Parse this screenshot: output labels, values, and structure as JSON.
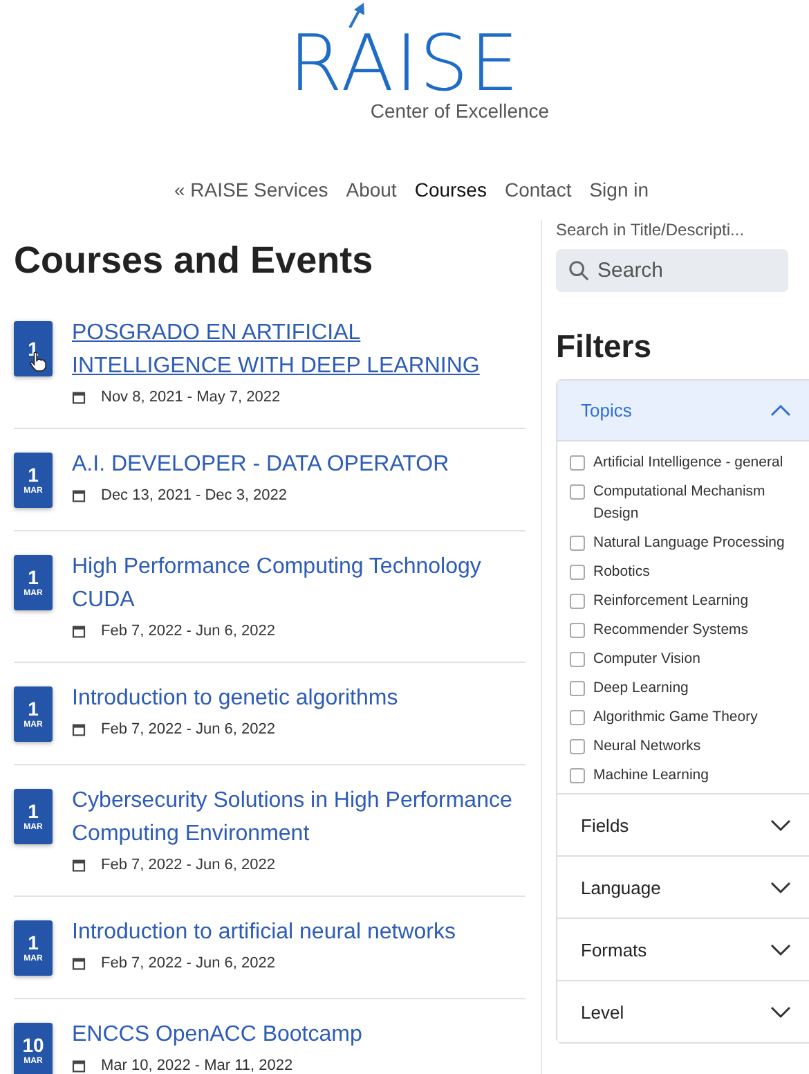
{
  "logo": {
    "name": "RAISE",
    "tagline": "Center of Excellence"
  },
  "nav": [
    {
      "label": "« RAISE Services",
      "selected": false
    },
    {
      "label": "About",
      "selected": false
    },
    {
      "label": "Courses",
      "selected": true
    },
    {
      "label": "Contact",
      "selected": false
    },
    {
      "label": "Sign in",
      "selected": false
    }
  ],
  "heading": "Courses and Events",
  "events": [
    {
      "day": "1",
      "title": "POSGRADO EN ARTIFICIAL INTELLIGENCE WITH DEEP LEARNING",
      "dates": "Nov 8, 2021 - May 7, 2022",
      "hovered": true
    },
    {
      "day": "1",
      "month": "MAR",
      "title": "A.I. DEVELOPER - DATA OPERATOR",
      "dates": "Dec 13, 2021 - Dec 3, 2022",
      "hovered": false
    },
    {
      "day": "1",
      "month": "MAR",
      "title": "High Performance Computing Technology CUDA",
      "dates": "Feb 7, 2022 - Jun 6, 2022",
      "hovered": false
    },
    {
      "day": "1",
      "month": "MAR",
      "title": "Introduction to genetic algorithms",
      "dates": "Feb 7, 2022 - Jun 6, 2022",
      "hovered": false
    },
    {
      "day": "1",
      "month": "MAR",
      "title": "Cybersecurity Solutions in High Performance Computing Environment",
      "dates": "Feb 7, 2022 - Jun 6, 2022",
      "hovered": false
    },
    {
      "day": "1",
      "month": "MAR",
      "title": "Introduction to artificial neural networks",
      "dates": "Feb 7, 2022 - Jun 6, 2022",
      "hovered": false
    },
    {
      "day": "10",
      "month": "MAR",
      "title": "ENCCS OpenACC Bootcamp",
      "dates": "Mar 10, 2022 - Mar 11, 2022",
      "hovered": false
    }
  ],
  "search": {
    "label": "Search in Title/Descripti...",
    "placeholder": "Search"
  },
  "filters": {
    "title": "Filters",
    "sections": [
      {
        "label": "Topics",
        "expanded": true,
        "options": [
          {
            "label": "Artificial Intelligence - general",
            "checked": false
          },
          {
            "label": "Computational Mechanism Design",
            "checked": false
          },
          {
            "label": "Natural Language Processing",
            "checked": false
          },
          {
            "label": "Robotics",
            "checked": false
          },
          {
            "label": "Reinforcement Learning",
            "checked": false
          },
          {
            "label": "Recommender Systems",
            "checked": false
          },
          {
            "label": "Computer Vision",
            "checked": false
          },
          {
            "label": "Deep Learning",
            "checked": false
          },
          {
            "label": "Algorithmic Game Theory",
            "checked": false
          },
          {
            "label": "Neural Networks",
            "checked": false
          },
          {
            "label": "Machine Learning",
            "checked": false
          }
        ]
      },
      {
        "label": "Fields",
        "expanded": false
      },
      {
        "label": "Language",
        "expanded": false
      },
      {
        "label": "Formats",
        "expanded": false
      },
      {
        "label": "Level",
        "expanded": false
      }
    ]
  }
}
